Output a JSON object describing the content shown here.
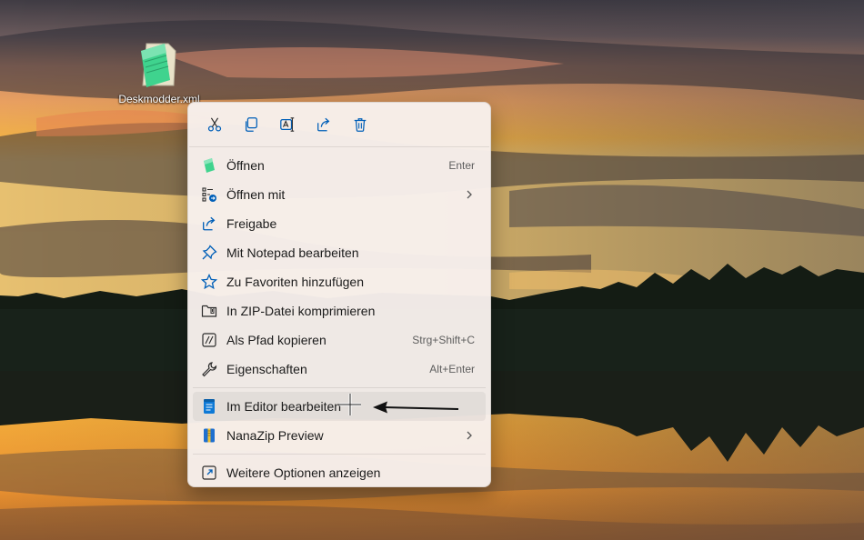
{
  "desktop": {
    "file_name": "Deskmodder.xml",
    "file_icon": "notepad-file-icon"
  },
  "toolbar": [
    {
      "name": "cut",
      "icon": "scissors-icon"
    },
    {
      "name": "copy",
      "icon": "copy-icon"
    },
    {
      "name": "rename",
      "icon": "rename-icon"
    },
    {
      "name": "share",
      "icon": "share-icon"
    },
    {
      "name": "delete",
      "icon": "trash-icon"
    }
  ],
  "menu": {
    "open": {
      "label": "Öffnen",
      "shortcut": "Enter",
      "icon": "notepad-icon"
    },
    "open_with": {
      "label": "Öffnen mit",
      "icon": "open-with-icon"
    },
    "share": {
      "label": "Freigabe",
      "icon": "share-icon"
    },
    "edit_notepad": {
      "label": "Mit Notepad bearbeiten",
      "icon": "pin-icon"
    },
    "favorites": {
      "label": "Zu Favoriten hinzufügen",
      "icon": "star-icon"
    },
    "zip": {
      "label": "In ZIP-Datei komprimieren",
      "icon": "zip-folder-icon"
    },
    "copy_path": {
      "label": "Als Pfad kopieren",
      "shortcut": "Strg+Shift+C",
      "icon": "copy-path-icon"
    },
    "properties": {
      "label": "Eigenschaften",
      "shortcut": "Alt+Enter",
      "icon": "wrench-icon"
    },
    "edit_editor": {
      "label": "Im Editor bearbeiten",
      "icon": "notepad-blue-icon"
    },
    "nanazip": {
      "label": "NanaZip Preview",
      "icon": "nanazip-icon"
    },
    "more_options": {
      "label": "Weitere Optionen anzeigen",
      "icon": "more-options-icon"
    }
  },
  "colors": {
    "accent": "#005fb8",
    "menu_bg": "#f7f0ec",
    "sky_top": "#3a3a44",
    "sunset_orange": "#f0a040",
    "water_gold": "#f5b03a"
  }
}
